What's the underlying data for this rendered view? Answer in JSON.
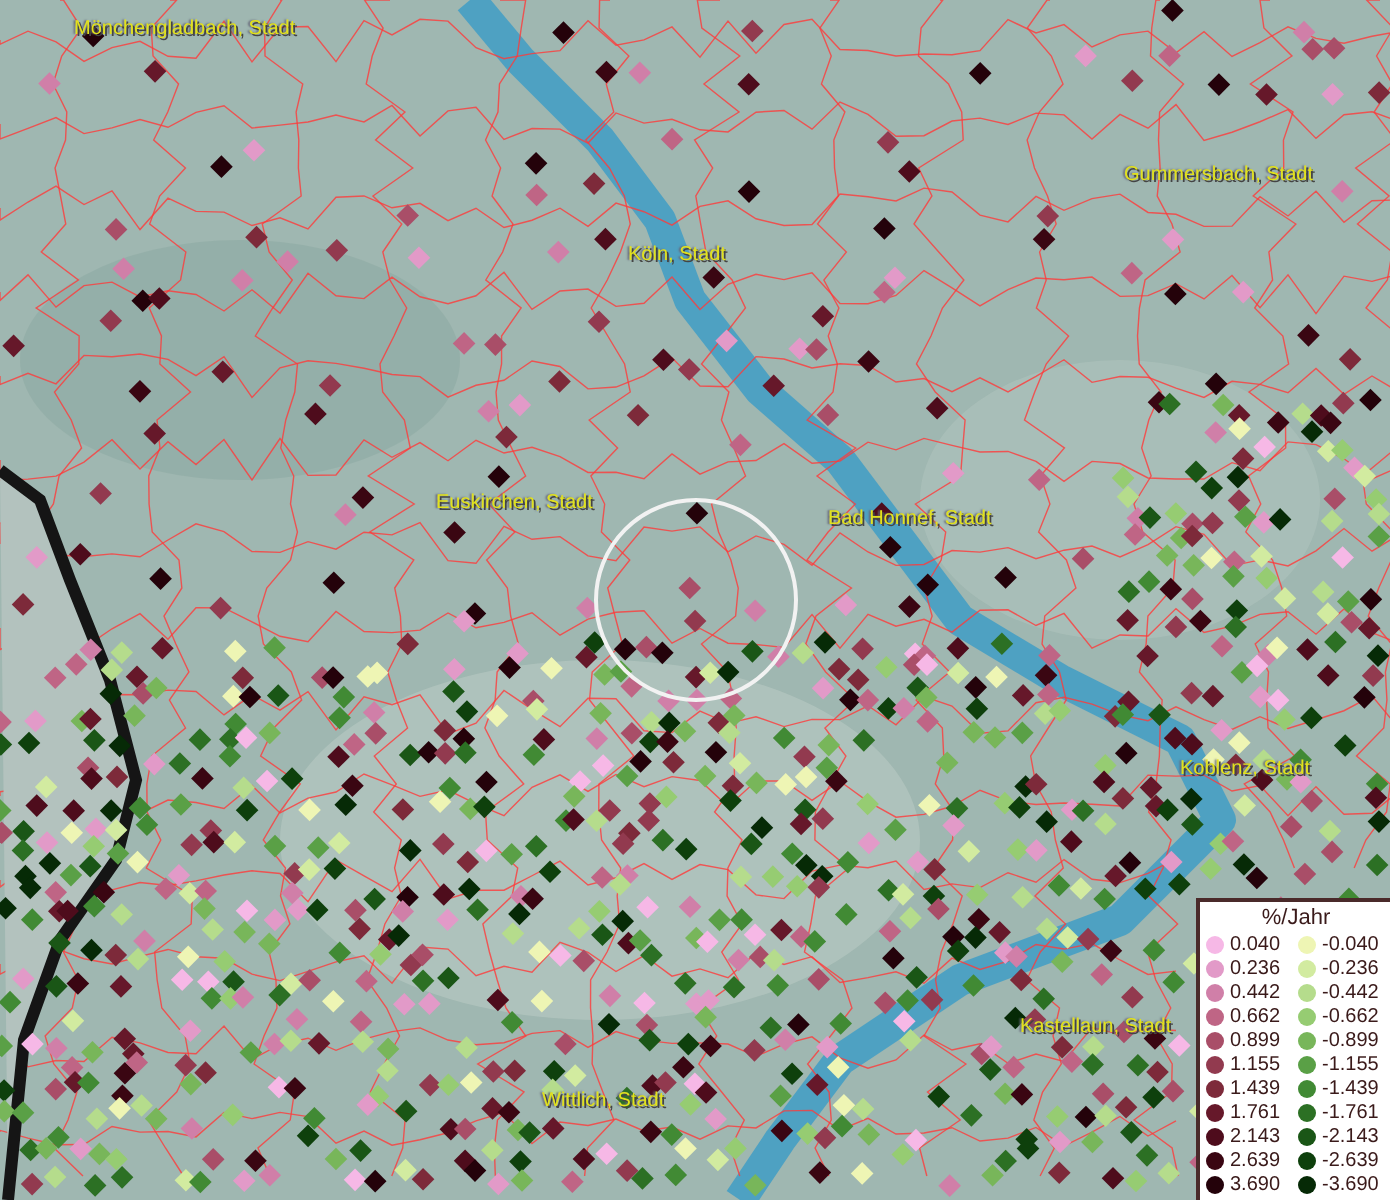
{
  "map": {
    "places": [
      "Mönchengladbach, Stadt",
      "Köln, Stadt",
      "Gummersbach, Stadt",
      "Euskirchen, Stadt",
      "Bad Honnef, Stadt",
      "Koblenz, Stadt",
      "Kastellaun, Stadt",
      "Wittlich, Stadt"
    ]
  },
  "legend": {
    "title": "%/Jahr",
    "positive": [
      {
        "value": "0.040",
        "color": "#f6b8e6"
      },
      {
        "value": "0.236",
        "color": "#e29ac8"
      },
      {
        "value": "0.442",
        "color": "#d07fa8"
      },
      {
        "value": "0.662",
        "color": "#bf6585"
      },
      {
        "value": "0.899",
        "color": "#a94e68"
      },
      {
        "value": "1.155",
        "color": "#923a4f"
      },
      {
        "value": "1.439",
        "color": "#7d2a3a"
      },
      {
        "value": "1.761",
        "color": "#66182a"
      },
      {
        "value": "2.143",
        "color": "#4e0c1c"
      },
      {
        "value": "2.639",
        "color": "#3a0612"
      },
      {
        "value": "3.690",
        "color": "#24020a"
      }
    ],
    "negative": [
      {
        "value": "-0.040",
        "color": "#eef5b4"
      },
      {
        "value": "-0.236",
        "color": "#d2eba0"
      },
      {
        "value": "-0.442",
        "color": "#b5dc8c"
      },
      {
        "value": "-0.662",
        "color": "#96cc72"
      },
      {
        "value": "-0.899",
        "color": "#78b65a"
      },
      {
        "value": "-1.155",
        "color": "#5aa046"
      },
      {
        "value": "-1.439",
        "color": "#418a34"
      },
      {
        "value": "-1.761",
        "color": "#2c7024"
      },
      {
        "value": "-2.143",
        "color": "#1a5616"
      },
      {
        "value": "-2.639",
        "color": "#0e400c"
      },
      {
        "value": "-3.690",
        "color": "#062a06"
      }
    ]
  }
}
